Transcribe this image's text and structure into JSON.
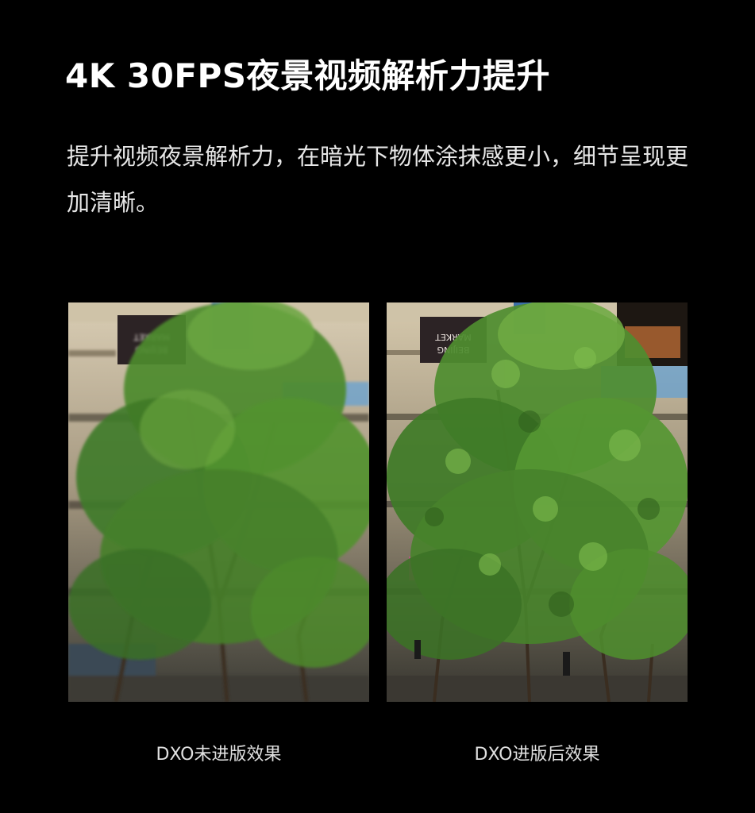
{
  "page": {
    "title": "4K 30FPS夜景视频解析力提升",
    "description": "提升视频夜景解析力，在暗光下物体涂抹感更小，细节呈现更加清晰。"
  },
  "comparison": {
    "left": {
      "caption": "DXO未进版效果",
      "sign_text": "BEIJING MARKET STREET"
    },
    "right": {
      "caption": "DXO进版后效果",
      "sign_text": "BEIJING MARKET STREET"
    }
  },
  "colors": {
    "background": "#000000",
    "text": "#ffffff",
    "foliage": "#4f8a2e",
    "building_light": "#e8dcc4"
  }
}
